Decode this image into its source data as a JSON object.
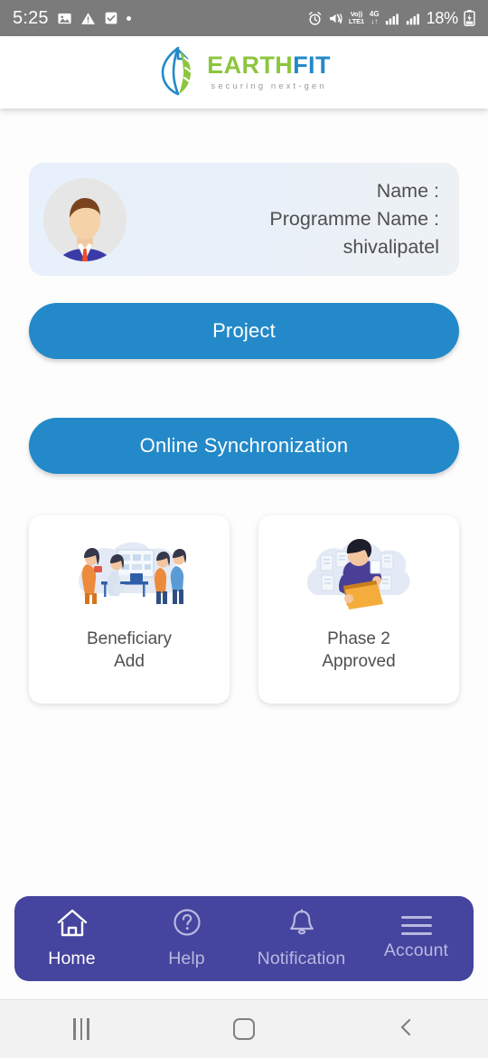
{
  "status_bar": {
    "time": "5:25",
    "battery": "18%",
    "left_icons": [
      "image-icon",
      "warning-icon",
      "checkbox-icon",
      "dot-icon"
    ],
    "right_icons": [
      "alarm-icon",
      "mute-vibrate-icon",
      "volte-icon",
      "4g-data-icon",
      "signal-icon-1",
      "signal-icon-2",
      "battery-icon"
    ],
    "volte_top": "Vo))",
    "volte_bottom": "LTE1",
    "network_top": "4G",
    "network_bottom": "↓↑",
    "bg_color": "#7b7b7b"
  },
  "app_bar": {
    "logo_primary": "EARTH",
    "logo_secondary": "FIT",
    "logo_tagline": "securing next-gen",
    "logo_icon": "leaf-logo-icon",
    "green": "#8cc63e",
    "blue": "#2389c9"
  },
  "profile": {
    "avatar_icon": "user-avatar",
    "name_label": "Name :",
    "programme_label": "Programme Name :",
    "username": "shivalipatel"
  },
  "buttons": {
    "project": "Project",
    "sync": "Online Synchronization",
    "accent": "#2389c9"
  },
  "tiles": [
    {
      "label_line1": "Beneficiary",
      "label_line2": "Add",
      "art": "office-meeting-illustration"
    },
    {
      "label_line1": "Phase 2",
      "label_line2": "Approved",
      "art": "person-with-folder-illustration"
    }
  ],
  "bottom_nav": {
    "bg_color": "#45449e",
    "items": [
      {
        "label": "Home",
        "icon": "home-icon",
        "active": true
      },
      {
        "label": "Help",
        "icon": "question-circle-icon",
        "active": false
      },
      {
        "label": "Notification",
        "icon": "bell-icon",
        "active": false
      },
      {
        "label": "Account",
        "icon": "hamburger-menu-icon",
        "active": false
      }
    ]
  },
  "android_nav": {
    "recents": "recents-icon",
    "home": "home-circle-icon",
    "back": "back-chevron-icon"
  }
}
